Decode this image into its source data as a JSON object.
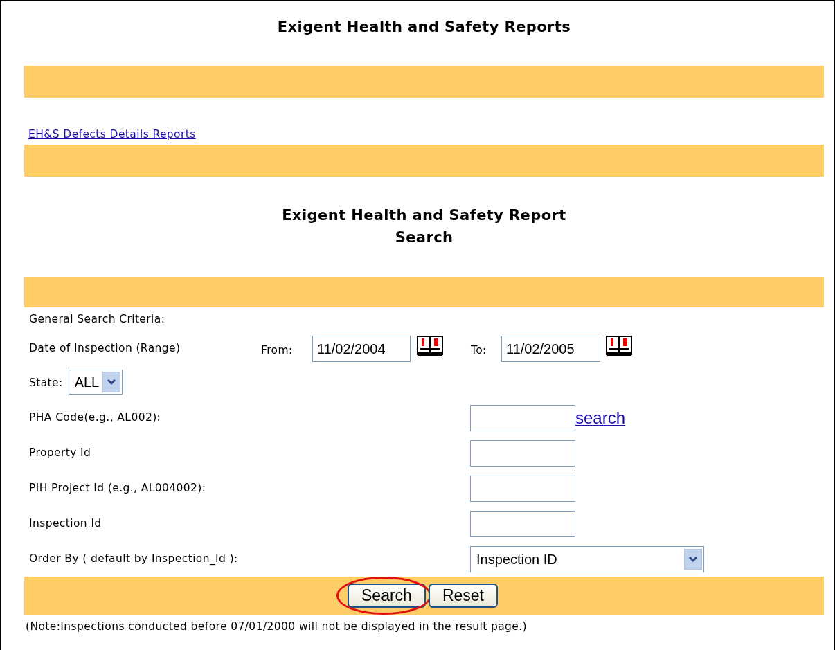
{
  "title": "Exigent Health and Safety Reports",
  "link": "EH&S Defects Details Reports",
  "heading_lines": [
    "Exigent Health and Safety Report",
    "Search"
  ],
  "criteria_label": "General Search Criteria:",
  "date_range": {
    "label": "Date of Inspection (Range)",
    "from_label": "From:",
    "from_value": "11/02/2004",
    "to_label": "To:",
    "to_value": "11/02/2005"
  },
  "state": {
    "label": "State:",
    "value": "ALL"
  },
  "fields": [
    {
      "kind": "text_link",
      "label": "PHA Code(e.g., AL002):",
      "link": "search"
    },
    {
      "kind": "text",
      "label": "Property Id"
    },
    {
      "kind": "text",
      "label": "PIH Project Id (e.g., AL004002):"
    },
    {
      "kind": "text",
      "label": "Inspection Id"
    },
    {
      "kind": "select",
      "label": "Order By ( default by Inspection_Id ):",
      "value": "Inspection ID"
    }
  ],
  "buttons": [
    {
      "label": "Search",
      "highlighted": true
    },
    {
      "label": "Reset",
      "highlighted": false
    }
  ],
  "note": "(Note:Inspections conducted before 07/01/2000 will not be displayed in the result page.)"
}
